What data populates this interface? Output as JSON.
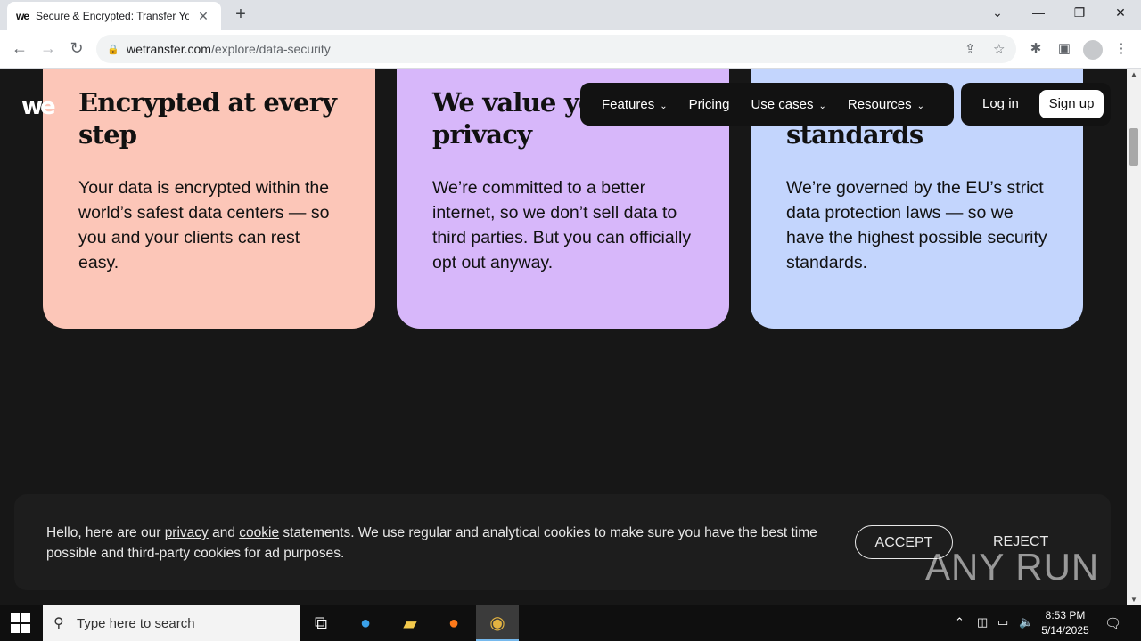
{
  "browser": {
    "tab_title": "Secure & Encrypted: Transfer Yo",
    "favicon_text": "we",
    "url_host": "wetransfer.com",
    "url_path": "/explore/data-security"
  },
  "page": {
    "logo": "we",
    "cards": [
      {
        "title": "Encrypted at every step",
        "body": "Your data is encrypted within the world’s safest data centers — so you and your clients can rest easy.",
        "color": "#fcc6b8"
      },
      {
        "title": "We value your privacy",
        "body": "We’re committed to a better internet, so we don’t sell data to third parties. But you can officially opt out anyway.",
        "color": "#d7b7fa"
      },
      {
        "title": "standards",
        "body": "We’re governed by the EU’s strict data protection laws — so we have the highest possible security standards.",
        "color": "#c3d5fd"
      }
    ],
    "nav": {
      "features": "Features",
      "pricing": "Pricing",
      "use_cases": "Use cases",
      "resources": "Resources",
      "login": "Log in",
      "signup": "Sign up"
    },
    "cookie": {
      "text_pre": "Hello, here are our ",
      "privacy_link": "privacy",
      "and": " and ",
      "cookie_link": "cookie",
      "text_post": " statements. We use regular and analytical cookies to make sure you have the best time possible and third-party cookies for ad purposes.",
      "accept": "ACCEPT",
      "reject": "REJECT"
    },
    "watermark": "ANY RUN"
  },
  "taskbar": {
    "search_placeholder": "Type here to search",
    "time": "8:53 PM",
    "date": "5/14/2025"
  }
}
